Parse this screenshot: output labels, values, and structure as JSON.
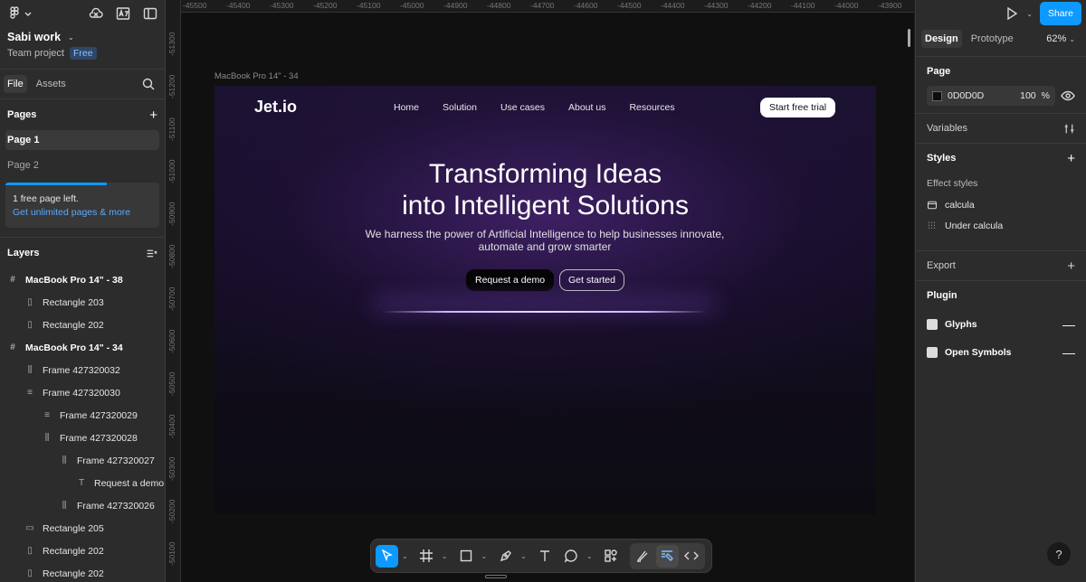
{
  "left": {
    "project_name": "Sabi work",
    "project_type": "Team project",
    "plan_badge": "Free",
    "tabs": [
      "File",
      "Assets"
    ],
    "pages_title": "Pages",
    "pages": [
      "Page 1",
      "Page 2"
    ],
    "upgrade_text": "1 free page left.",
    "upgrade_link": "Get unlimited pages & more",
    "layers_title": "Layers",
    "layers": [
      {
        "name": "MacBook Pro 14\" - 38",
        "icon": "#",
        "indent": 0,
        "top": true
      },
      {
        "name": "Rectangle 203",
        "icon": "▯",
        "indent": 1
      },
      {
        "name": "Rectangle 202",
        "icon": "▯",
        "indent": 1
      },
      {
        "name": "MacBook Pro 14\" - 34",
        "icon": "#",
        "indent": 0,
        "top": true
      },
      {
        "name": "Frame 427320032",
        "icon": "⫼",
        "indent": 1
      },
      {
        "name": "Frame 427320030",
        "icon": "≡",
        "indent": 1
      },
      {
        "name": "Frame 427320029",
        "icon": "≡",
        "indent": 2
      },
      {
        "name": "Frame 427320028",
        "icon": "⫼",
        "indent": 2
      },
      {
        "name": "Frame 427320027",
        "icon": "⫼",
        "indent": 3
      },
      {
        "name": "Request a demo",
        "icon": "T",
        "indent": 4
      },
      {
        "name": "Frame 427320026",
        "icon": "⫼",
        "indent": 3
      },
      {
        "name": "Rectangle 205",
        "icon": "▭",
        "indent": 1
      },
      {
        "name": "Rectangle 202",
        "icon": "▯",
        "indent": 1
      },
      {
        "name": "Rectangle 202",
        "icon": "▯",
        "indent": 1
      }
    ]
  },
  "canvas": {
    "ruler_top": [
      "-45500",
      "-45400",
      "-45300",
      "-45200",
      "-45100",
      "-45000",
      "-44900",
      "-44800",
      "-44700",
      "-44600",
      "-44500",
      "-44400",
      "-44300",
      "-44200",
      "-44100",
      "-44000",
      "-43900"
    ],
    "ruler_left": [
      "-51300",
      "-51200",
      "-51100",
      "-51000",
      "-50900",
      "-50800",
      "-50700",
      "-50600",
      "-50500",
      "-50400",
      "-50300",
      "-50200",
      "-50100"
    ],
    "frame_label": "MacBook Pro 14\" - 34",
    "site": {
      "brand": "Jet.io",
      "nav": [
        "Home",
        "Solution",
        "Use cases",
        "About us",
        "Resources"
      ],
      "cta": "Start free trial",
      "title_line1": "Transforming Ideas",
      "title_line2": "into Intelligent Solutions",
      "subtitle": "We harness the power of Artificial Intelligence to help businesses innovate, automate and grow smarter",
      "btn_demo": "Request a demo",
      "btn_start": "Get started"
    }
  },
  "right": {
    "share": "Share",
    "tabs": [
      "Design",
      "Prototype"
    ],
    "zoom": "62%",
    "page_title": "Page",
    "page_color": "0D0D0D",
    "page_opacity": "100",
    "percent": "%",
    "variables": "Variables",
    "styles": "Styles",
    "effect_styles": "Effect styles",
    "effects": [
      "calcula",
      "Under calcula"
    ],
    "export": "Export",
    "plugin": "Plugin",
    "plugins": [
      "Glyphs",
      "Open Symbols"
    ],
    "help": "?"
  }
}
